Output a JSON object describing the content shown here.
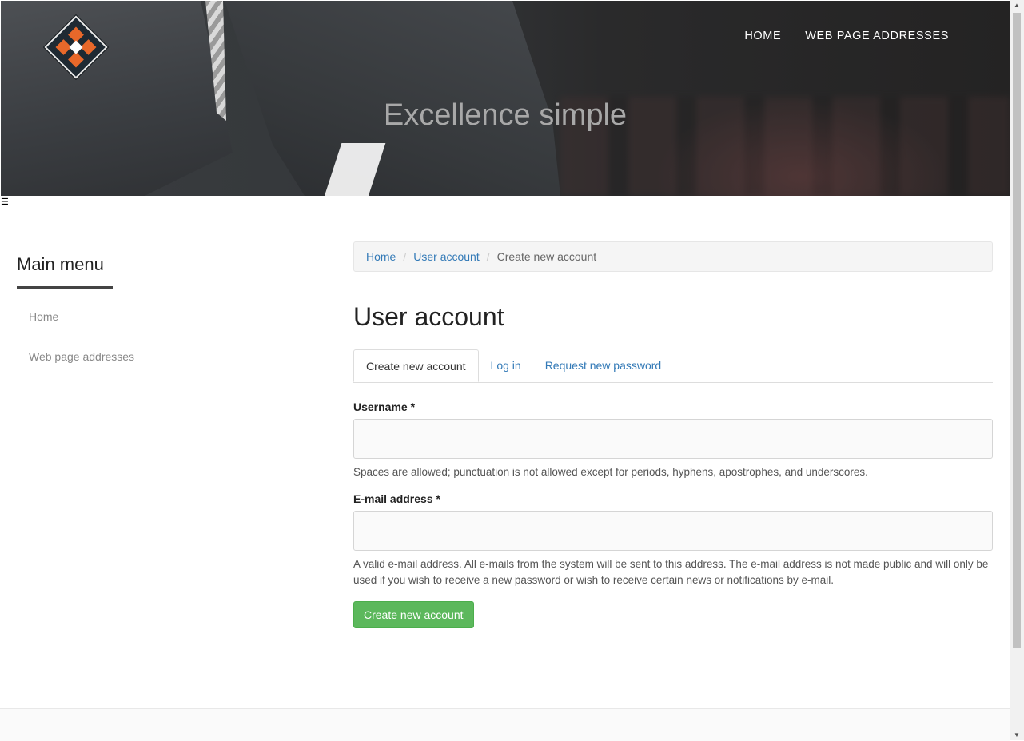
{
  "header": {
    "nav": [
      "HOME",
      "WEB PAGE ADDRESSES"
    ],
    "hero_title": "Excellence simple"
  },
  "sidebar": {
    "title": "Main menu",
    "items": [
      "Home",
      "Web page addresses"
    ]
  },
  "breadcrumb": {
    "items": [
      "Home",
      "User account"
    ],
    "active": "Create new account"
  },
  "page": {
    "title": "User account"
  },
  "tabs": [
    "Create new account",
    "Log in",
    "Request new password"
  ],
  "form": {
    "username": {
      "label": "Username *",
      "value": "",
      "help": "Spaces are allowed; punctuation is not allowed except for periods, hyphens, apostrophes, and underscores."
    },
    "email": {
      "label": "E-mail address *",
      "value": "",
      "help": "A valid e-mail address. All e-mails from the system will be sent to this address. The e-mail address is not made public and will only be used if you wish to receive a new password or wish to receive certain news or notifications by e-mail."
    },
    "submit_label": "Create new account"
  },
  "colors": {
    "link": "#337ab7",
    "accent_orange": "#e8682a",
    "button_green": "#5cb85c"
  }
}
